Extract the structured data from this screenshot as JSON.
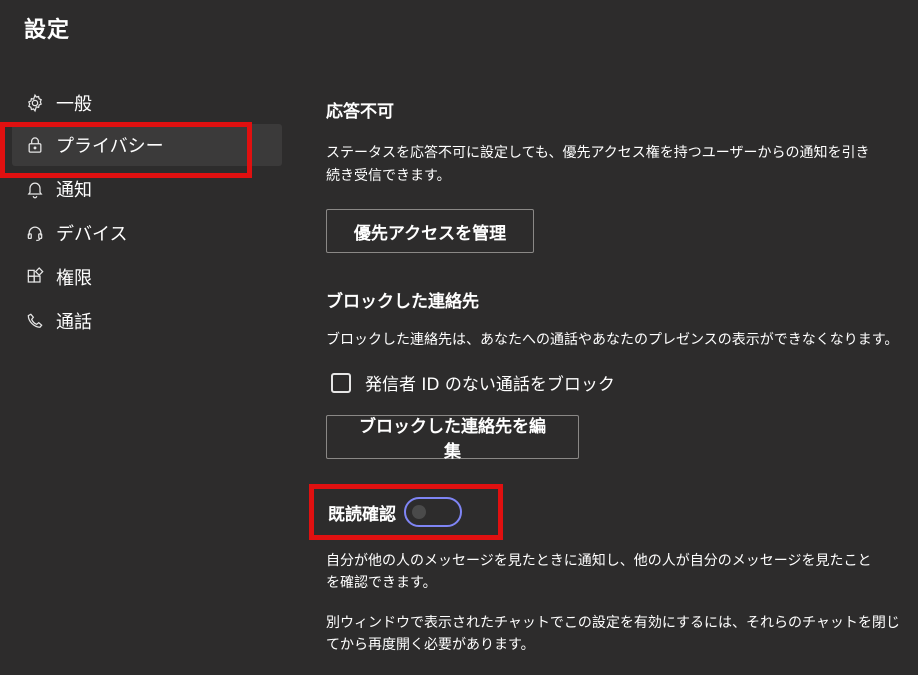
{
  "window": {
    "title": "設定"
  },
  "sidebar": {
    "items": [
      {
        "id": "general",
        "label": "一般",
        "icon": "gear-icon"
      },
      {
        "id": "privacy",
        "label": "プライバシー",
        "icon": "lock-icon",
        "active": true
      },
      {
        "id": "notifications",
        "label": "通知",
        "icon": "bell-icon"
      },
      {
        "id": "devices",
        "label": "デバイス",
        "icon": "headset-icon"
      },
      {
        "id": "permissions",
        "label": "権限",
        "icon": "apps-icon"
      },
      {
        "id": "calls",
        "label": "通話",
        "icon": "phone-icon"
      }
    ]
  },
  "dnd": {
    "heading": "応答不可",
    "description_line1": "ステータスを応答不可に設定しても、優先アクセス権を持つユーザーからの通知を引き",
    "description_line2": "続き受信できます。",
    "button_label": "優先アクセスを管理"
  },
  "blocked": {
    "heading": "ブロックした連絡先",
    "description": "ブロックした連絡先は、あなたへの通話やあなたのプレゼンスの表示ができなくなります。",
    "checkbox_label": "発信者 ID のない通話をブロック",
    "checkbox_checked": false,
    "button_label": "ブロックした連絡先を編集"
  },
  "read_receipts": {
    "label": "既読確認",
    "enabled": false,
    "description1_line1": "自分が他の人のメッセージを見たときに通知し、他の人が自分のメッセージを見たこと",
    "description1_line2": "を確認できます。",
    "description2_line1": "別ウィンドウで表示されたチャットでこの設定を有効にするには、それらのチャットを閉じ",
    "description2_line2": "てから再度開く必要があります。"
  },
  "colors": {
    "background": "#2d2c2c",
    "highlight": "#e01010",
    "toggle_border": "#7f85f5"
  }
}
